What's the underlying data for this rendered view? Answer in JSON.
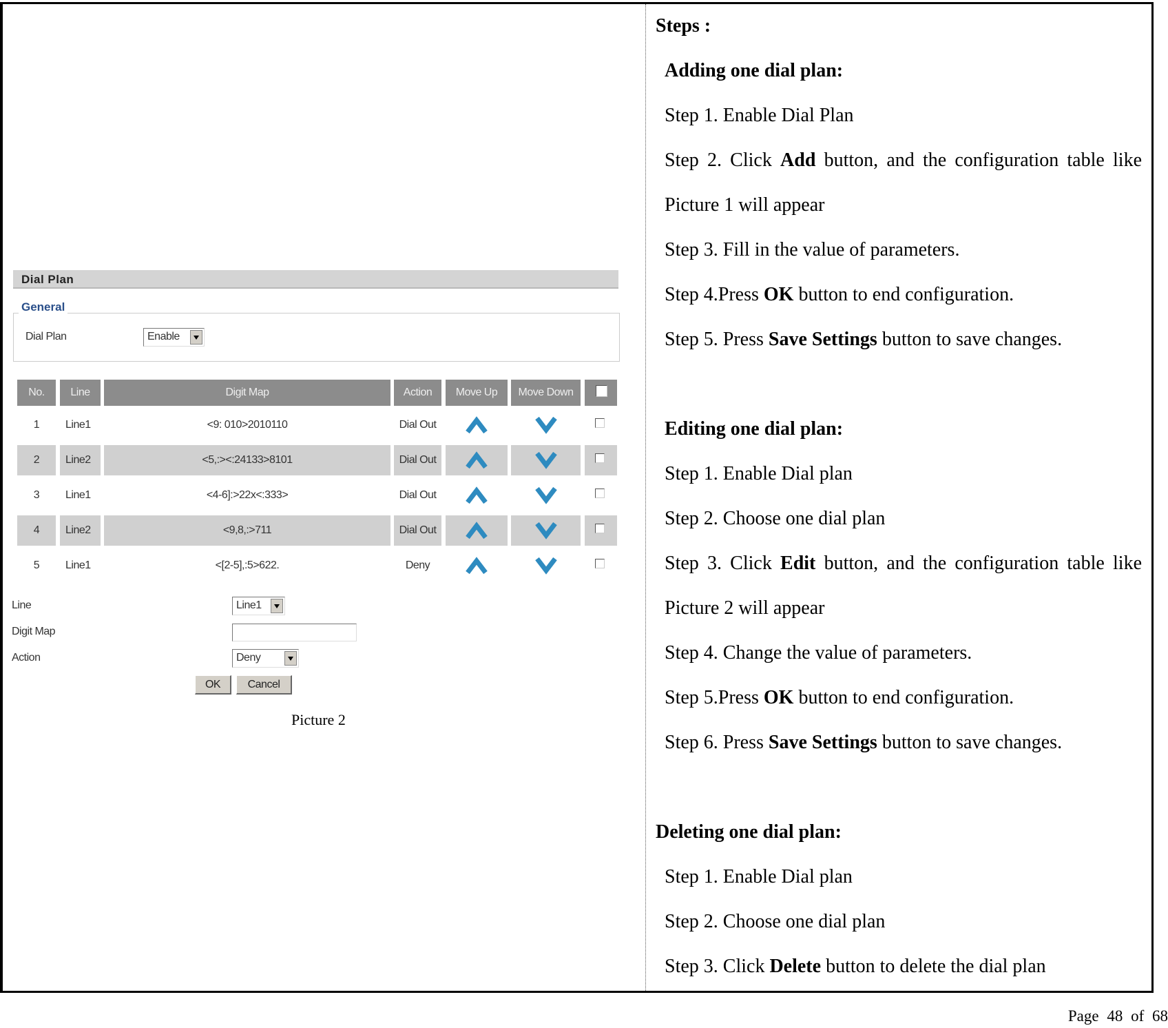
{
  "ui": {
    "section_title": "Dial Plan",
    "general_legend": "General",
    "dial_plan_label": "Dial Plan",
    "dial_plan_value": "Enable",
    "table": {
      "headers": [
        "No.",
        "Line",
        "Digit Map",
        "Action",
        "Move Up",
        "Move Down"
      ],
      "rows": [
        {
          "no": "1",
          "line": "Line1",
          "digit_map": "<9:  010>2010110",
          "action": "Dial Out"
        },
        {
          "no": "2",
          "line": "Line2",
          "digit_map": "<5,:><:24133>8101",
          "action": "Dial Out"
        },
        {
          "no": "3",
          "line": "Line1",
          "digit_map": "<4-6]:>22x<:333>",
          "action": "Dial Out"
        },
        {
          "no": "4",
          "line": "Line2",
          "digit_map": "<9,8,:>711",
          "action": "Dial Out"
        },
        {
          "no": "5",
          "line": "Line1",
          "digit_map": "<[2-5],:5>622.",
          "action": "Deny"
        }
      ]
    },
    "form": {
      "line_label": "Line",
      "line_value": "Line1",
      "digit_map_label": "Digit Map",
      "digit_map_value": "",
      "action_label": "Action",
      "action_value": "Deny",
      "ok_label": "OK",
      "cancel_label": "Cancel"
    },
    "arrow_color": "#2e8bc0"
  },
  "caption": "Picture 2",
  "steps": [
    {
      "pre": "",
      "bold": "Steps :",
      "post": "",
      "indent": false
    },
    {
      "pre": "",
      "bold": "Adding one dial plan:",
      "post": "",
      "indent": true
    },
    {
      "pre": "Step 1. Enable Dial Plan",
      "bold": "",
      "post": "",
      "indent": true
    },
    {
      "pre": "Step 2. Click ",
      "bold": "Add",
      "post": " button, and the configuration table like",
      "indent": true,
      "justify": true
    },
    {
      "pre": "Picture 1 will appear",
      "bold": "",
      "post": "",
      "indent": true
    },
    {
      "pre": "Step 3. Fill in the value of parameters.",
      "bold": "",
      "post": "",
      "indent": true
    },
    {
      "pre": "Step 4.Press ",
      "bold": "OK",
      "post": " button to end configuration.",
      "indent": true
    },
    {
      "pre": "Step 5. Press ",
      "bold": "Save Settings",
      "post": " button to save changes.",
      "indent": true
    },
    {
      "pre": "",
      "bold": "Editing one dial plan:",
      "post": "",
      "indent": true,
      "gap": true
    },
    {
      "pre": "Step 1. Enable Dial plan",
      "bold": "",
      "post": "",
      "indent": true
    },
    {
      "pre": "Step 2. Choose one dial plan",
      "bold": "",
      "post": "",
      "indent": true
    },
    {
      "pre": "Step 3. Click ",
      "bold": "Edit",
      "post": " button, and the configuration table like",
      "indent": true,
      "justify": true
    },
    {
      "pre": "Picture 2 will appear",
      "bold": "",
      "post": "",
      "indent": true
    },
    {
      "pre": "Step 4. Change the value of parameters.",
      "bold": "",
      "post": "",
      "indent": true
    },
    {
      "pre": "Step 5.Press ",
      "bold": "OK",
      "post": " button to end configuration.",
      "indent": true
    },
    {
      "pre": "Step 6. Press ",
      "bold": "Save Settings",
      "post": " button to save changes.",
      "indent": true
    },
    {
      "pre": "",
      "bold": "Deleting one dial plan:",
      "post": "",
      "indent": false,
      "gap": true
    },
    {
      "pre": "Step 1. Enable Dial plan",
      "bold": "",
      "post": "",
      "indent": true
    },
    {
      "pre": "Step 2. Choose one dial plan",
      "bold": "",
      "post": "",
      "indent": true
    },
    {
      "pre": "Step 3. Click ",
      "bold": "Delete",
      "post": " button to delete the dial plan",
      "indent": true
    }
  ],
  "footer": {
    "page_label": "Page",
    "page": "48",
    "of_label": "of",
    "total": "68"
  }
}
